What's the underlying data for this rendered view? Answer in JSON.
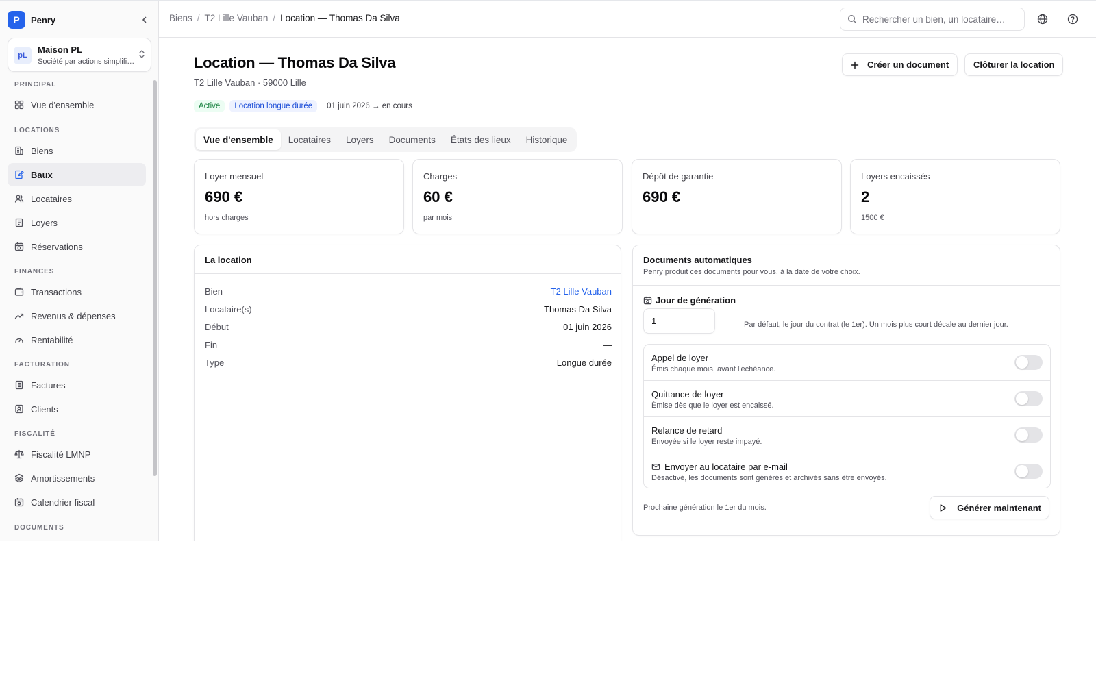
{
  "app": {
    "name": "Penry",
    "logo_letter": "P"
  },
  "org": {
    "initials": "pL",
    "name": "Maison PL",
    "subtitle": "Société par actions simplifiée"
  },
  "sidebar": {
    "sections": {
      "principal": "Principal",
      "locations": "Locations",
      "finances": "Finances",
      "facturation": "Facturation",
      "fiscalite": "Fiscalité",
      "documents": "Documents"
    },
    "items": {
      "overview": "Vue d'ensemble",
      "biens": "Biens",
      "baux": "Baux",
      "locataires": "Locataires",
      "loyers": "Loyers",
      "reservations": "Réservations",
      "transactions": "Transactions",
      "revenus": "Revenus & dépenses",
      "rentabilite": "Rentabilité",
      "factures": "Factures",
      "clients": "Clients",
      "lmnp": "Fiscalité LMNP",
      "amortissements": "Amortissements",
      "calendrier": "Calendrier fiscal"
    }
  },
  "topbar": {
    "breadcrumb": [
      "Biens",
      "T2 Lille Vauban",
      "Location — Thomas Da Silva"
    ],
    "search_placeholder": "Rechercher un bien, un locataire…"
  },
  "page": {
    "title": "Location — Thomas Da Silva",
    "subtitle": "T2 Lille Vauban · 59000 Lille",
    "badges": {
      "status": "Active",
      "type": "Location longue durée",
      "period": "01 juin 2026 → en cours"
    },
    "actions": {
      "create_doc": "Créer un document",
      "close": "Clôturer la location"
    },
    "tabs": [
      "Vue d'ensemble",
      "Locataires",
      "Loyers",
      "Documents",
      "États des lieux",
      "Historique"
    ]
  },
  "stats": [
    {
      "label": "Loyer mensuel",
      "value": "690 €",
      "note": "hors charges"
    },
    {
      "label": "Charges",
      "value": "60 €",
      "note": "par mois"
    },
    {
      "label": "Dépôt de garantie",
      "value": "690 €",
      "note": ""
    },
    {
      "label": "Loyers encaissés",
      "value": "2",
      "note": "1500 €"
    }
  ],
  "location": {
    "title": "La location",
    "rows": [
      {
        "key": "Bien",
        "value": "T2 Lille Vauban"
      },
      {
        "key": "Locataire(s)",
        "value": "Thomas Da Silva"
      },
      {
        "key": "Début",
        "value": "01 juin 2026"
      },
      {
        "key": "Fin",
        "value": "—"
      },
      {
        "key": "Type",
        "value": "Longue durée"
      }
    ]
  },
  "auto_docs": {
    "title": "Documents automatiques",
    "description": "Penry produit ces documents pour vous, à la date de votre choix.",
    "gen_day_label": "Jour de génération",
    "gen_day_value": "1",
    "gen_day_help": "Par défaut, le jour du contrat (le 1er). Un mois plus court décale au dernier jour.",
    "toggles": [
      {
        "title": "Appel de loyer",
        "desc": "Émis chaque mois, avant l'échéance.",
        "enabled": false
      },
      {
        "title": "Quittance de loyer",
        "desc": "Émise dès que le loyer est encaissé.",
        "enabled": false
      },
      {
        "title": "Relance de retard",
        "desc": "Envoyée si le loyer reste impayé.",
        "enabled": false
      },
      {
        "title": "Envoyer au locataire par e-mail",
        "desc": "Désactivé, les documents sont générés et archivés sans être envoyés.",
        "enabled": false
      }
    ],
    "next_generation": "Prochaine génération le 1er du mois.",
    "generate_now": "Générer maintenant"
  },
  "colors": {
    "accent": "#2563eb",
    "success": "#15803d",
    "border": "#e4e4e7"
  }
}
